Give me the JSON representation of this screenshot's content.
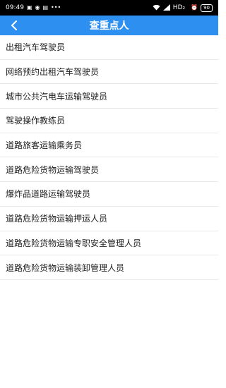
{
  "status_bar": {
    "time": "09:49",
    "network": "HD₂",
    "battery": "90",
    "icons": [
      "message-icon",
      "wechat-icon",
      "notification-icon",
      "more-icon",
      "wifi-icon",
      "signal-icon",
      "alarm-icon",
      "battery-icon"
    ]
  },
  "header": {
    "title": "查重点人",
    "back_icon": "chevron-left-icon",
    "background": "#2d8ff0"
  },
  "list": {
    "items": [
      {
        "label": "出租汽车驾驶员"
      },
      {
        "label": "网络预约出租汽车驾驶员"
      },
      {
        "label": "城市公共汽电车运输驾驶员"
      },
      {
        "label": "驾驶操作教练员"
      },
      {
        "label": "道路旅客运输乘务员"
      },
      {
        "label": "道路危险货物运输驾驶员"
      },
      {
        "label": "爆炸品道路运输驾驶员"
      },
      {
        "label": "道路危险货物运输押运人员"
      },
      {
        "label": "道路危险货物运输专职安全管理人员"
      },
      {
        "label": "道路危险货物运输装卸管理人员"
      }
    ]
  }
}
